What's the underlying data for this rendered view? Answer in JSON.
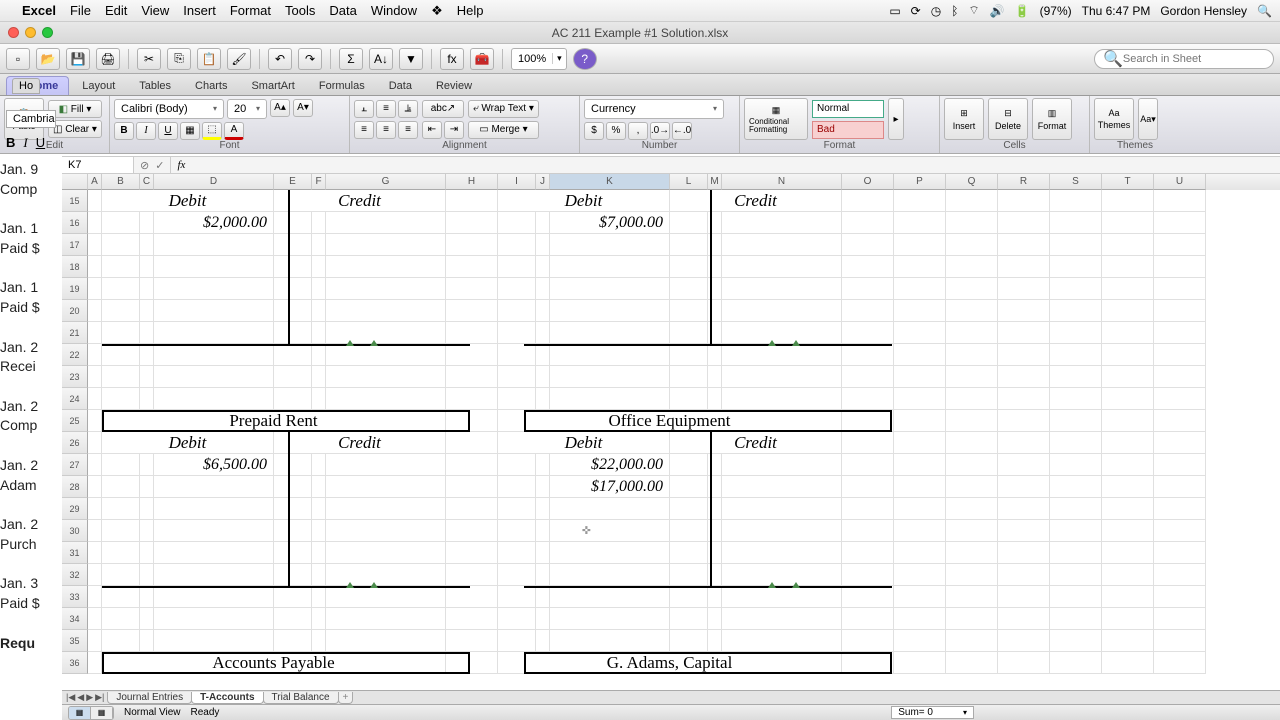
{
  "mac": {
    "app": "Excel",
    "menus": [
      "File",
      "Edit",
      "View",
      "Insert",
      "Format",
      "Tools",
      "Data",
      "Window",
      "Help"
    ],
    "battery": "(97%)",
    "clock": "Thu 6:47 PM",
    "user": "Gordon Hensley"
  },
  "window": {
    "title": "AC 211 Example #1 Solution.xlsx"
  },
  "toolbar": {
    "zoom": "100%",
    "search_ph": "Search in Sheet"
  },
  "ribbon": {
    "tabs": [
      "Home",
      "Layout",
      "Tables",
      "Charts",
      "SmartArt",
      "Formulas",
      "Data",
      "Review"
    ],
    "groups": {
      "edit": "Edit",
      "font": "Font",
      "align": "Alignment",
      "number": "Number",
      "format": "Format",
      "cells": "Cells",
      "themes": "Themes"
    },
    "paste": "Paste",
    "fill": "Fill",
    "clear": "Clear",
    "font_name": "Calibri (Body)",
    "font_size": "20",
    "wrap": "Wrap Text",
    "merge": "Merge",
    "num_fmt": "Currency",
    "cond": "Conditional Formatting",
    "normal": "Normal",
    "bad": "Bad",
    "insert": "Insert",
    "delete": "Delete",
    "formatc": "Format",
    "themes": "Themes"
  },
  "side": {
    "tab": "Ho",
    "font": "Cambria",
    "lines": [
      "Jan. 9",
      "Comp",
      "Jan. 1",
      "Paid $",
      "Jan. 1",
      "Paid $",
      "Jan. 2",
      "Recei",
      "Jan. 2",
      "Comp",
      "Jan. 2",
      "Adam",
      "Jan. 2",
      "Purch",
      "Jan. 3",
      "Paid $",
      "Requ"
    ]
  },
  "fbar": {
    "name": "K7"
  },
  "cols": [
    "A",
    "B",
    "C",
    "D",
    "E",
    "F",
    "G",
    "H",
    "I",
    "J",
    "K",
    "L",
    "M",
    "N",
    "O",
    "P",
    "Q",
    "R",
    "S",
    "T",
    "U"
  ],
  "row_start": 15,
  "row_end": 36,
  "accounts": {
    "top_left": {
      "debit_h": "Debit",
      "credit_h": "Credit",
      "d1": "$2,000.00"
    },
    "top_right": {
      "debit_h": "Debit",
      "credit_h": "Credit",
      "d1": "$7,000.00"
    },
    "prepaid": {
      "title": "Prepaid Rent",
      "debit_h": "Debit",
      "credit_h": "Credit",
      "d1": "$6,500.00"
    },
    "equip": {
      "title": "Office Equipment",
      "debit_h": "Debit",
      "credit_h": "Credit",
      "d1": "$22,000.00",
      "d2": "$17,000.00"
    },
    "ap": {
      "title": "Accounts Payable"
    },
    "cap": {
      "title": "G. Adams, Capital"
    }
  },
  "sheet_tabs": [
    "Journal Entries",
    "T-Accounts",
    "Trial Balance"
  ],
  "status": {
    "view": "Normal View",
    "ready": "Ready",
    "sum": "Sum= 0"
  }
}
